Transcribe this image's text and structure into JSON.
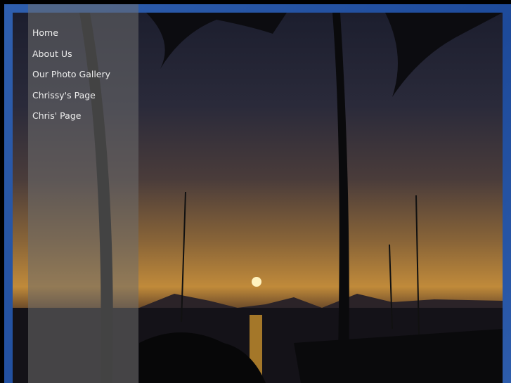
{
  "nav": {
    "items": [
      {
        "label": "Home"
      },
      {
        "label": "About Us"
      },
      {
        "label": "Our Photo Gallery"
      },
      {
        "label": "Chrissy's Page"
      },
      {
        "label": "Chris' Page"
      }
    ]
  },
  "colors": {
    "frame": "#2f5fae",
    "sidebar": "#6e6e6e",
    "text": "#eeeeee"
  }
}
